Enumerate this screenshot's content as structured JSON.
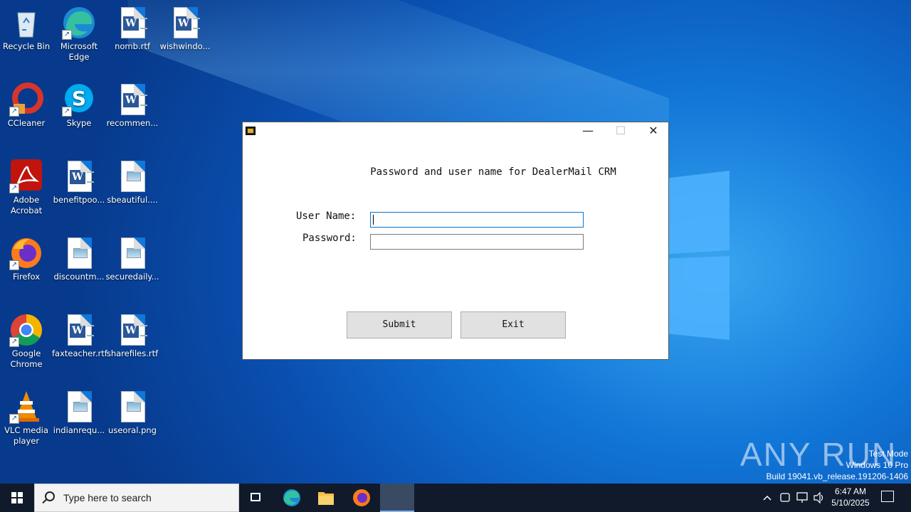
{
  "desktop": {
    "icons": [
      {
        "label": "Recycle Bin"
      },
      {
        "label": "Microsoft Edge"
      },
      {
        "label": "nomb.rtf"
      },
      {
        "label": "wishwindo..."
      },
      {
        "label": "CCleaner"
      },
      {
        "label": "Skype"
      },
      {
        "label": "recommen..."
      },
      {
        "label": "Adobe Acrobat"
      },
      {
        "label": "benefitpoo..."
      },
      {
        "label": "sbeautiful...."
      },
      {
        "label": "Firefox"
      },
      {
        "label": "discountm..."
      },
      {
        "label": "securedaily..."
      },
      {
        "label": "Google Chrome"
      },
      {
        "label": "faxteacher.rtf"
      },
      {
        "label": "sharefiles.rtf"
      },
      {
        "label": "VLC media player"
      },
      {
        "label": "indianrequ..."
      },
      {
        "label": "useoral.png"
      }
    ]
  },
  "dialog": {
    "heading": "Password and user name for DealerMail CRM",
    "username_label": "User Name:",
    "password_label": "Password:",
    "username_value": "",
    "password_value": "",
    "submit_label": "Submit",
    "exit_label": "Exit",
    "minimize_glyph": "—",
    "maximize_glyph": "☐",
    "close_glyph": "✕"
  },
  "taskbar": {
    "search_placeholder": "Type here to search",
    "time": "6:47 AM",
    "date": "5/10/2025"
  },
  "watermark": {
    "brand": "ANY RUN",
    "line1": "Test Mode",
    "line2": "Windows 10 Pro",
    "line3": "Build 19041.vb_release.191206-1406"
  },
  "colors": {
    "accent": "#0078d7",
    "taskbar": "#101a2b"
  }
}
